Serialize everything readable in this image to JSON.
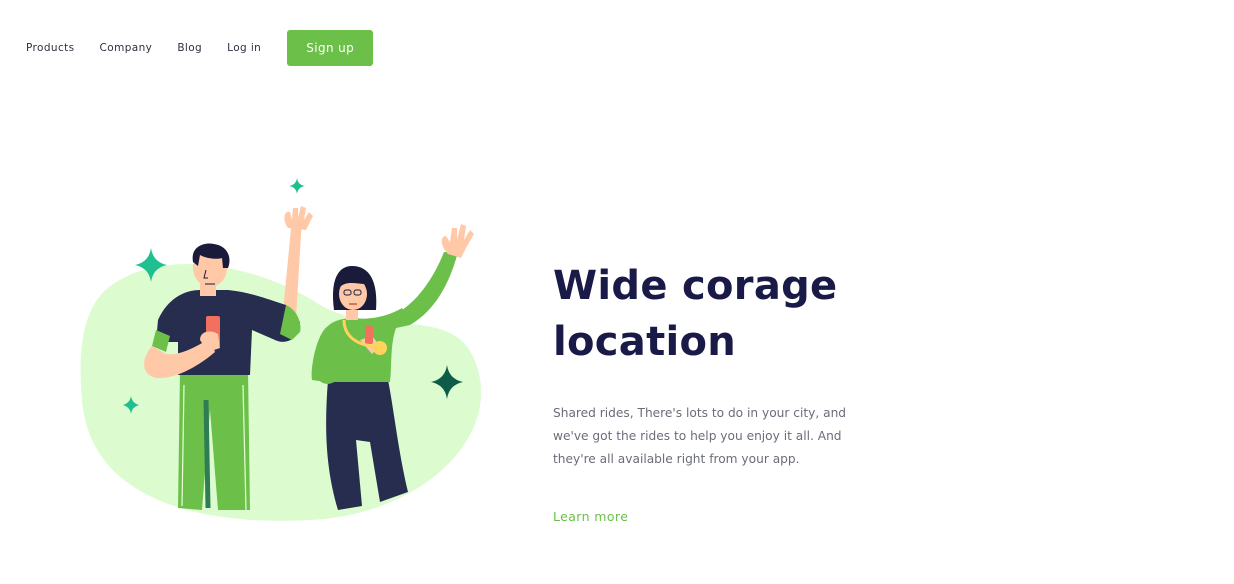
{
  "nav": {
    "items": [
      {
        "label": "Products"
      },
      {
        "label": "Company"
      },
      {
        "label": "Blog"
      },
      {
        "label": "Log in"
      }
    ],
    "signup_label": "Sign up"
  },
  "hero": {
    "title_line1": "Wide corage",
    "title_line2": "location",
    "description": "Shared rides, There's lots to do in your city, and we've got the rides to help you enjoy it all. And they're all available right from your app.",
    "cta_label": "Learn more"
  },
  "colors": {
    "accent": "#6cc04a",
    "heading": "#191a47",
    "body_text": "#6b6d7a",
    "blob": "#dcfcd0",
    "sparkle": "#1fbf8f"
  }
}
